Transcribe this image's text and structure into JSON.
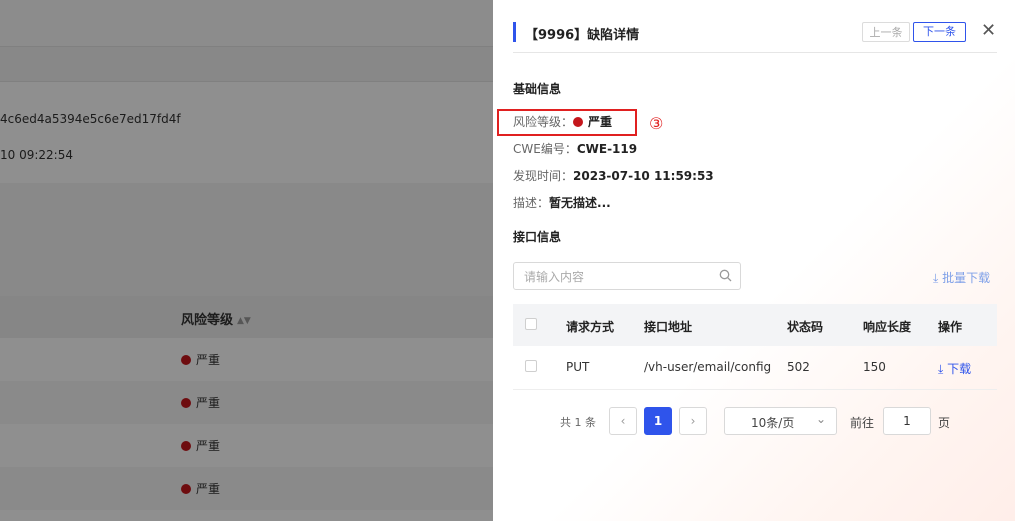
{
  "background": {
    "hash_text": "4c6ed4a5394e5c6e7ed17fd4f",
    "time_text": "10 09:22:54",
    "column_header": "风险等级",
    "rows": [
      "严重",
      "严重",
      "严重",
      "严重"
    ]
  },
  "drawer": {
    "title": "【9996】缺陷详情",
    "prev_label": "上一条",
    "next_label": "下一条",
    "basic_section": "基础信息",
    "risk": {
      "label": "风险等级：",
      "value": "严重",
      "color": "#c4161c"
    },
    "cwe": {
      "label": "CWE编号：",
      "value": "CWE-119"
    },
    "found_time": {
      "label": "发现时间：",
      "value": "2023-07-10 11:59:53"
    },
    "description": {
      "label": "描述：",
      "value": "暂无描述..."
    },
    "annotation_number": "③",
    "api_section": "接口信息",
    "search_placeholder": "请输入内容",
    "bulk_download": "批量下载",
    "table": {
      "headers": [
        "请求方式",
        "接口地址",
        "状态码",
        "响应长度",
        "操作"
      ],
      "rows": [
        {
          "method": "PUT",
          "path": "/vh-user/email/config",
          "status": "502",
          "length": "150",
          "action": "下载"
        }
      ]
    },
    "pagination": {
      "total": "共 1 条",
      "current_page": "1",
      "page_size": "10条/页",
      "goto_label": "前往",
      "goto_value": "1",
      "page_suffix": "页"
    }
  },
  "colors": {
    "accent": "#2f54eb",
    "danger": "#c4161c",
    "annotation": "#e02020"
  }
}
